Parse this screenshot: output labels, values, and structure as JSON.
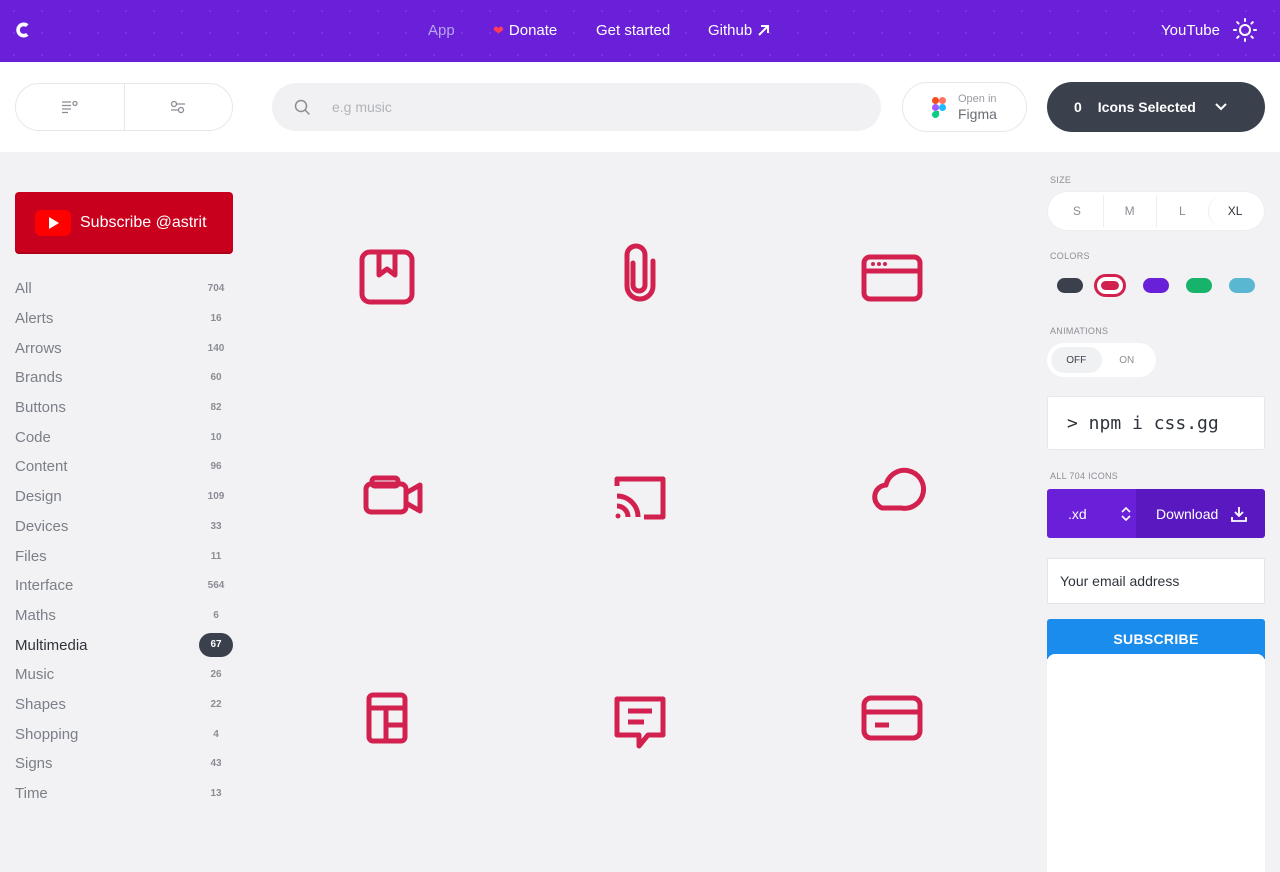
{
  "topbar": {
    "nav": [
      {
        "label": "App"
      },
      {
        "label": "Donate"
      },
      {
        "label": "Get started"
      },
      {
        "label": "Github"
      }
    ],
    "youtube_label": "YouTube"
  },
  "toolbar": {
    "search_placeholder": "e.g music",
    "figma_small": "Open in",
    "figma_big": "Figma",
    "selected_count": "0",
    "selected_label": "Icons Selected"
  },
  "sidebar": {
    "subscribe_label": "Subscribe @astrit",
    "categories": [
      {
        "name": "All",
        "count": "704"
      },
      {
        "name": "Alerts",
        "count": "16"
      },
      {
        "name": "Arrows",
        "count": "140"
      },
      {
        "name": "Brands",
        "count": "60"
      },
      {
        "name": "Buttons",
        "count": "82"
      },
      {
        "name": "Code",
        "count": "10"
      },
      {
        "name": "Content",
        "count": "96"
      },
      {
        "name": "Design",
        "count": "109"
      },
      {
        "name": "Devices",
        "count": "33"
      },
      {
        "name": "Files",
        "count": "11"
      },
      {
        "name": "Interface",
        "count": "564"
      },
      {
        "name": "Maths",
        "count": "6"
      },
      {
        "name": "Multimedia",
        "count": "67",
        "active": true
      },
      {
        "name": "Music",
        "count": "26"
      },
      {
        "name": "Shapes",
        "count": "22"
      },
      {
        "name": "Shopping",
        "count": "4"
      },
      {
        "name": "Signs",
        "count": "43"
      },
      {
        "name": "Time",
        "count": "13"
      }
    ]
  },
  "grid": {
    "icon_color": "#d2214f",
    "icons": [
      "bookmark-icon",
      "attachment-icon",
      "browser-icon",
      "camera-icon",
      "screen-cast-icon",
      "cloud-icon",
      "layout-icon",
      "comment-icon",
      "credit-card-icon"
    ]
  },
  "panel": {
    "size_label": "SIZE",
    "sizes": [
      "S",
      "M",
      "L",
      "XL"
    ],
    "selected_size": "XL",
    "colors_label": "COLORS",
    "colors": [
      "#3a414d",
      "#d2214f",
      "#6a1fd8",
      "#18b36b",
      "#5ab7d2"
    ],
    "selected_color": "#d2214f",
    "animations_label": "ANIMATIONS",
    "anim_off": "OFF",
    "anim_on": "ON",
    "npm_command": "> npm i css.gg",
    "all_icons_label": "ALL 704 ICONS",
    "format": ".xd",
    "download_label": "Download",
    "email_placeholder": "Your email address",
    "subscribe_button": "SUBSCRIBE"
  },
  "colors": {
    "brand_purple": "#6a1fd8",
    "dark": "#3a414d",
    "youtube_red": "#c8001e",
    "subscribe_blue": "#1a8ceb"
  }
}
